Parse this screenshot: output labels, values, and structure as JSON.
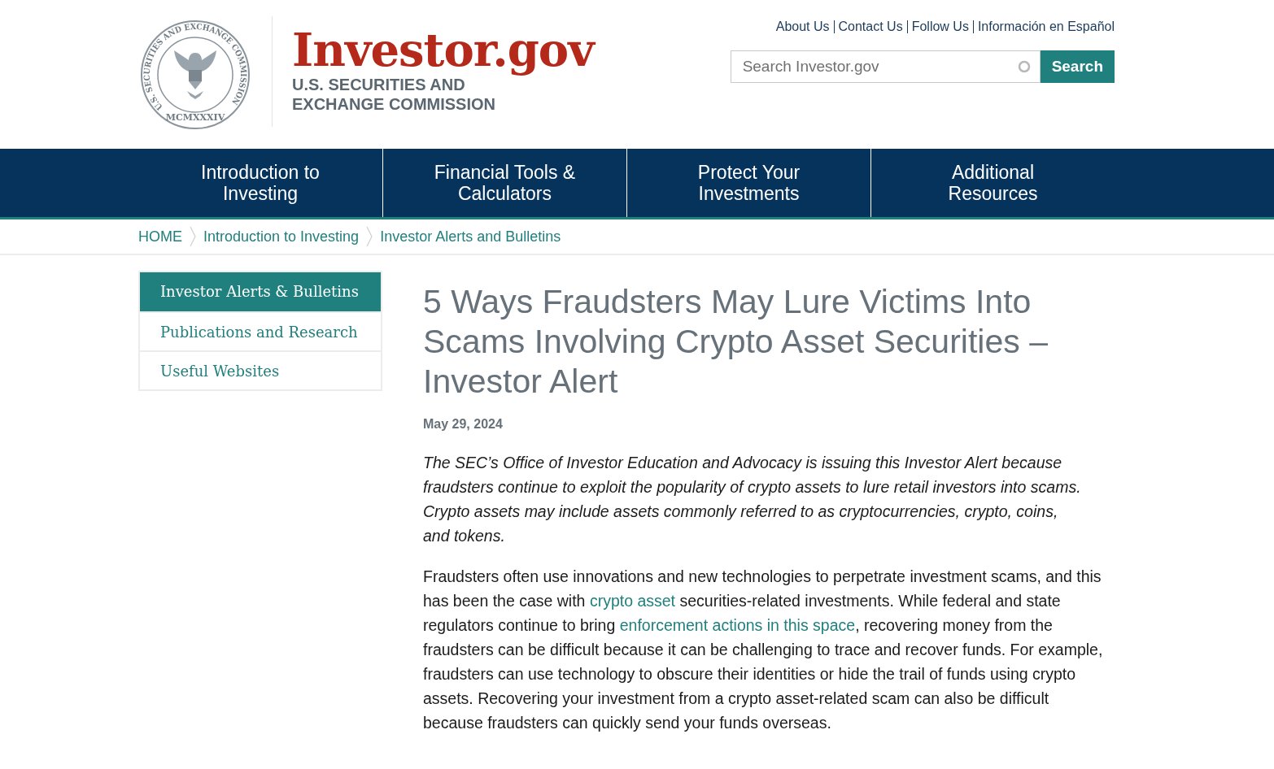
{
  "seal": {
    "ring_text": "U.S. SECURITIES AND EXCHANGE COMMISSION",
    "year": "MCMXXXIV"
  },
  "logo": {
    "title": "Investor.gov",
    "subtitle_lines": [
      "U.S. SECURITIES AND",
      "EXCHANGE COMMISSION"
    ]
  },
  "utility_links": [
    "About Us",
    "Contact Us",
    "Follow Us",
    "Información en Español"
  ],
  "search": {
    "placeholder": "Search Investor.gov",
    "button": "Search"
  },
  "nav": [
    {
      "label": "Introduction to Investing"
    },
    {
      "label": "Financial Tools & Calculators"
    },
    {
      "label": "Protect Your Investments"
    },
    {
      "label": "Additional Resources"
    }
  ],
  "breadcrumbs": [
    "HOME",
    "Introduction to Investing",
    "Investor Alerts and Bulletins"
  ],
  "sidebar": {
    "items": [
      {
        "label": "Investor Alerts & Bulletins",
        "selected": true
      },
      {
        "label": "Publications and Research",
        "selected": false
      },
      {
        "label": "Useful Websites",
        "selected": false
      }
    ]
  },
  "article": {
    "title": "5 Ways Fraudsters May Lure Victims Into Scams Involving Crypto Asset Securities – Investor Alert",
    "date": "May 29, 2024",
    "intro": "The SEC’s Office of Investor Education and Advocacy is issuing this Investor Alert because fraudsters continue to exploit the popularity of crypto assets to lure retail investors into scams. Crypto assets may include assets commonly referred to as cryptocurrencies, crypto, coins, and tokens.",
    "paragraph": [
      {
        "kind": "text",
        "text": "Fraudsters often use innovations and new technologies to perpetrate investment scams, and this has been the case with "
      },
      {
        "kind": "link",
        "text": "crypto asset"
      },
      {
        "kind": "text",
        "text": " securities-related investments. While federal and state regulators continue to bring "
      },
      {
        "kind": "link",
        "text": "enforcement actions in this space"
      },
      {
        "kind": "text",
        "text": ", recovering money from the fraudsters can be difficult because it can be challenging to trace and recover funds. For example, fraudsters can use technology to obscure their identities or hide the trail of funds using crypto assets. Recovering your investment from a crypto asset-related scam can also be difficult because fraudsters can quickly send your funds overseas."
      }
    ]
  }
}
